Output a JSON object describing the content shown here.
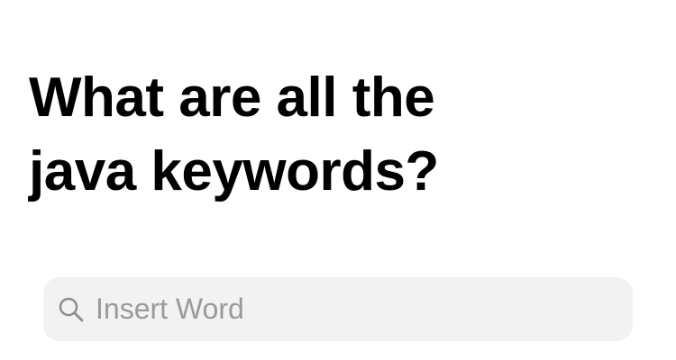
{
  "header": {
    "title_line_1": "What are all the",
    "title_line_2": "java keywords?"
  },
  "search": {
    "icon": "search-icon",
    "value": "",
    "placeholder": "Insert Word"
  },
  "colors": {
    "title": "#000000",
    "search_background": "#f2f2f2",
    "placeholder": "#9a9a9e"
  }
}
